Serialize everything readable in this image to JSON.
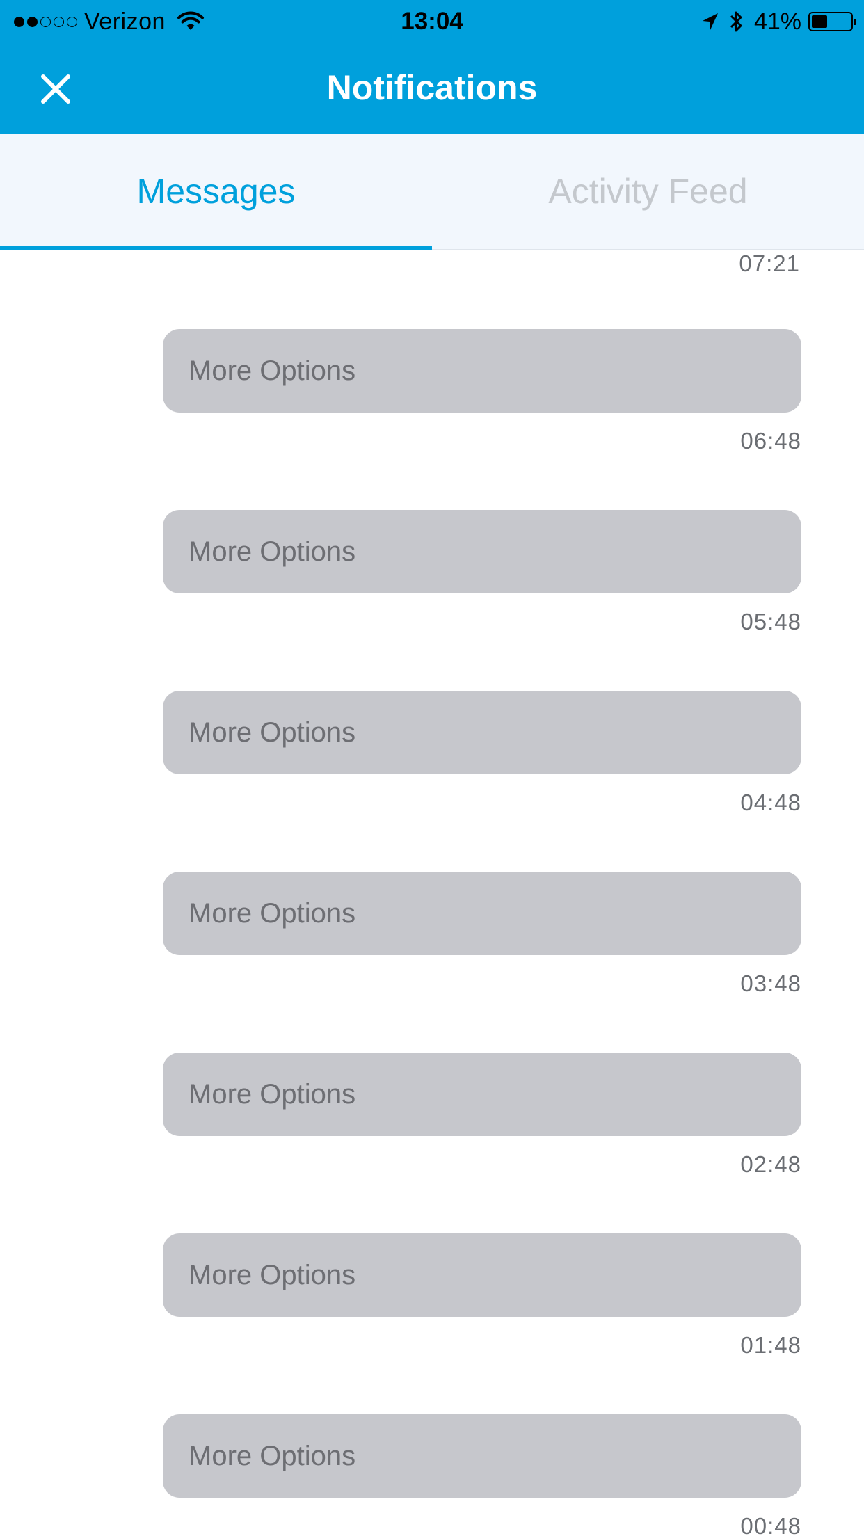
{
  "status_bar": {
    "signal_dots": [
      true,
      true,
      false,
      false,
      false
    ],
    "carrier": "Verizon",
    "time": "13:04",
    "battery_percent": "41%",
    "battery_level": 0.41,
    "icons": [
      "wifi-icon",
      "location-arrow-icon",
      "bluetooth-icon",
      "battery-icon"
    ]
  },
  "header": {
    "title": "Notifications",
    "close_icon": "close-icon"
  },
  "tabs": [
    {
      "label": "Messages",
      "active": true
    },
    {
      "label": "Activity Feed",
      "active": false
    }
  ],
  "messages": {
    "first_time": "07:21",
    "items": [
      {
        "label": "More Options",
        "time": "06:48"
      },
      {
        "label": "More Options",
        "time": "05:48"
      },
      {
        "label": "More Options",
        "time": "04:48"
      },
      {
        "label": "More Options",
        "time": "03:48"
      },
      {
        "label": "More Options",
        "time": "02:48"
      },
      {
        "label": "More Options",
        "time": "01:48"
      },
      {
        "label": "More Options",
        "time": "00:48"
      }
    ]
  },
  "colors": {
    "brand_blue": "#00a0dc",
    "tab_background": "#f2f7fd",
    "bubble_gray": "#c6c7cc",
    "inactive_tab_text": "#c4c8cd"
  }
}
